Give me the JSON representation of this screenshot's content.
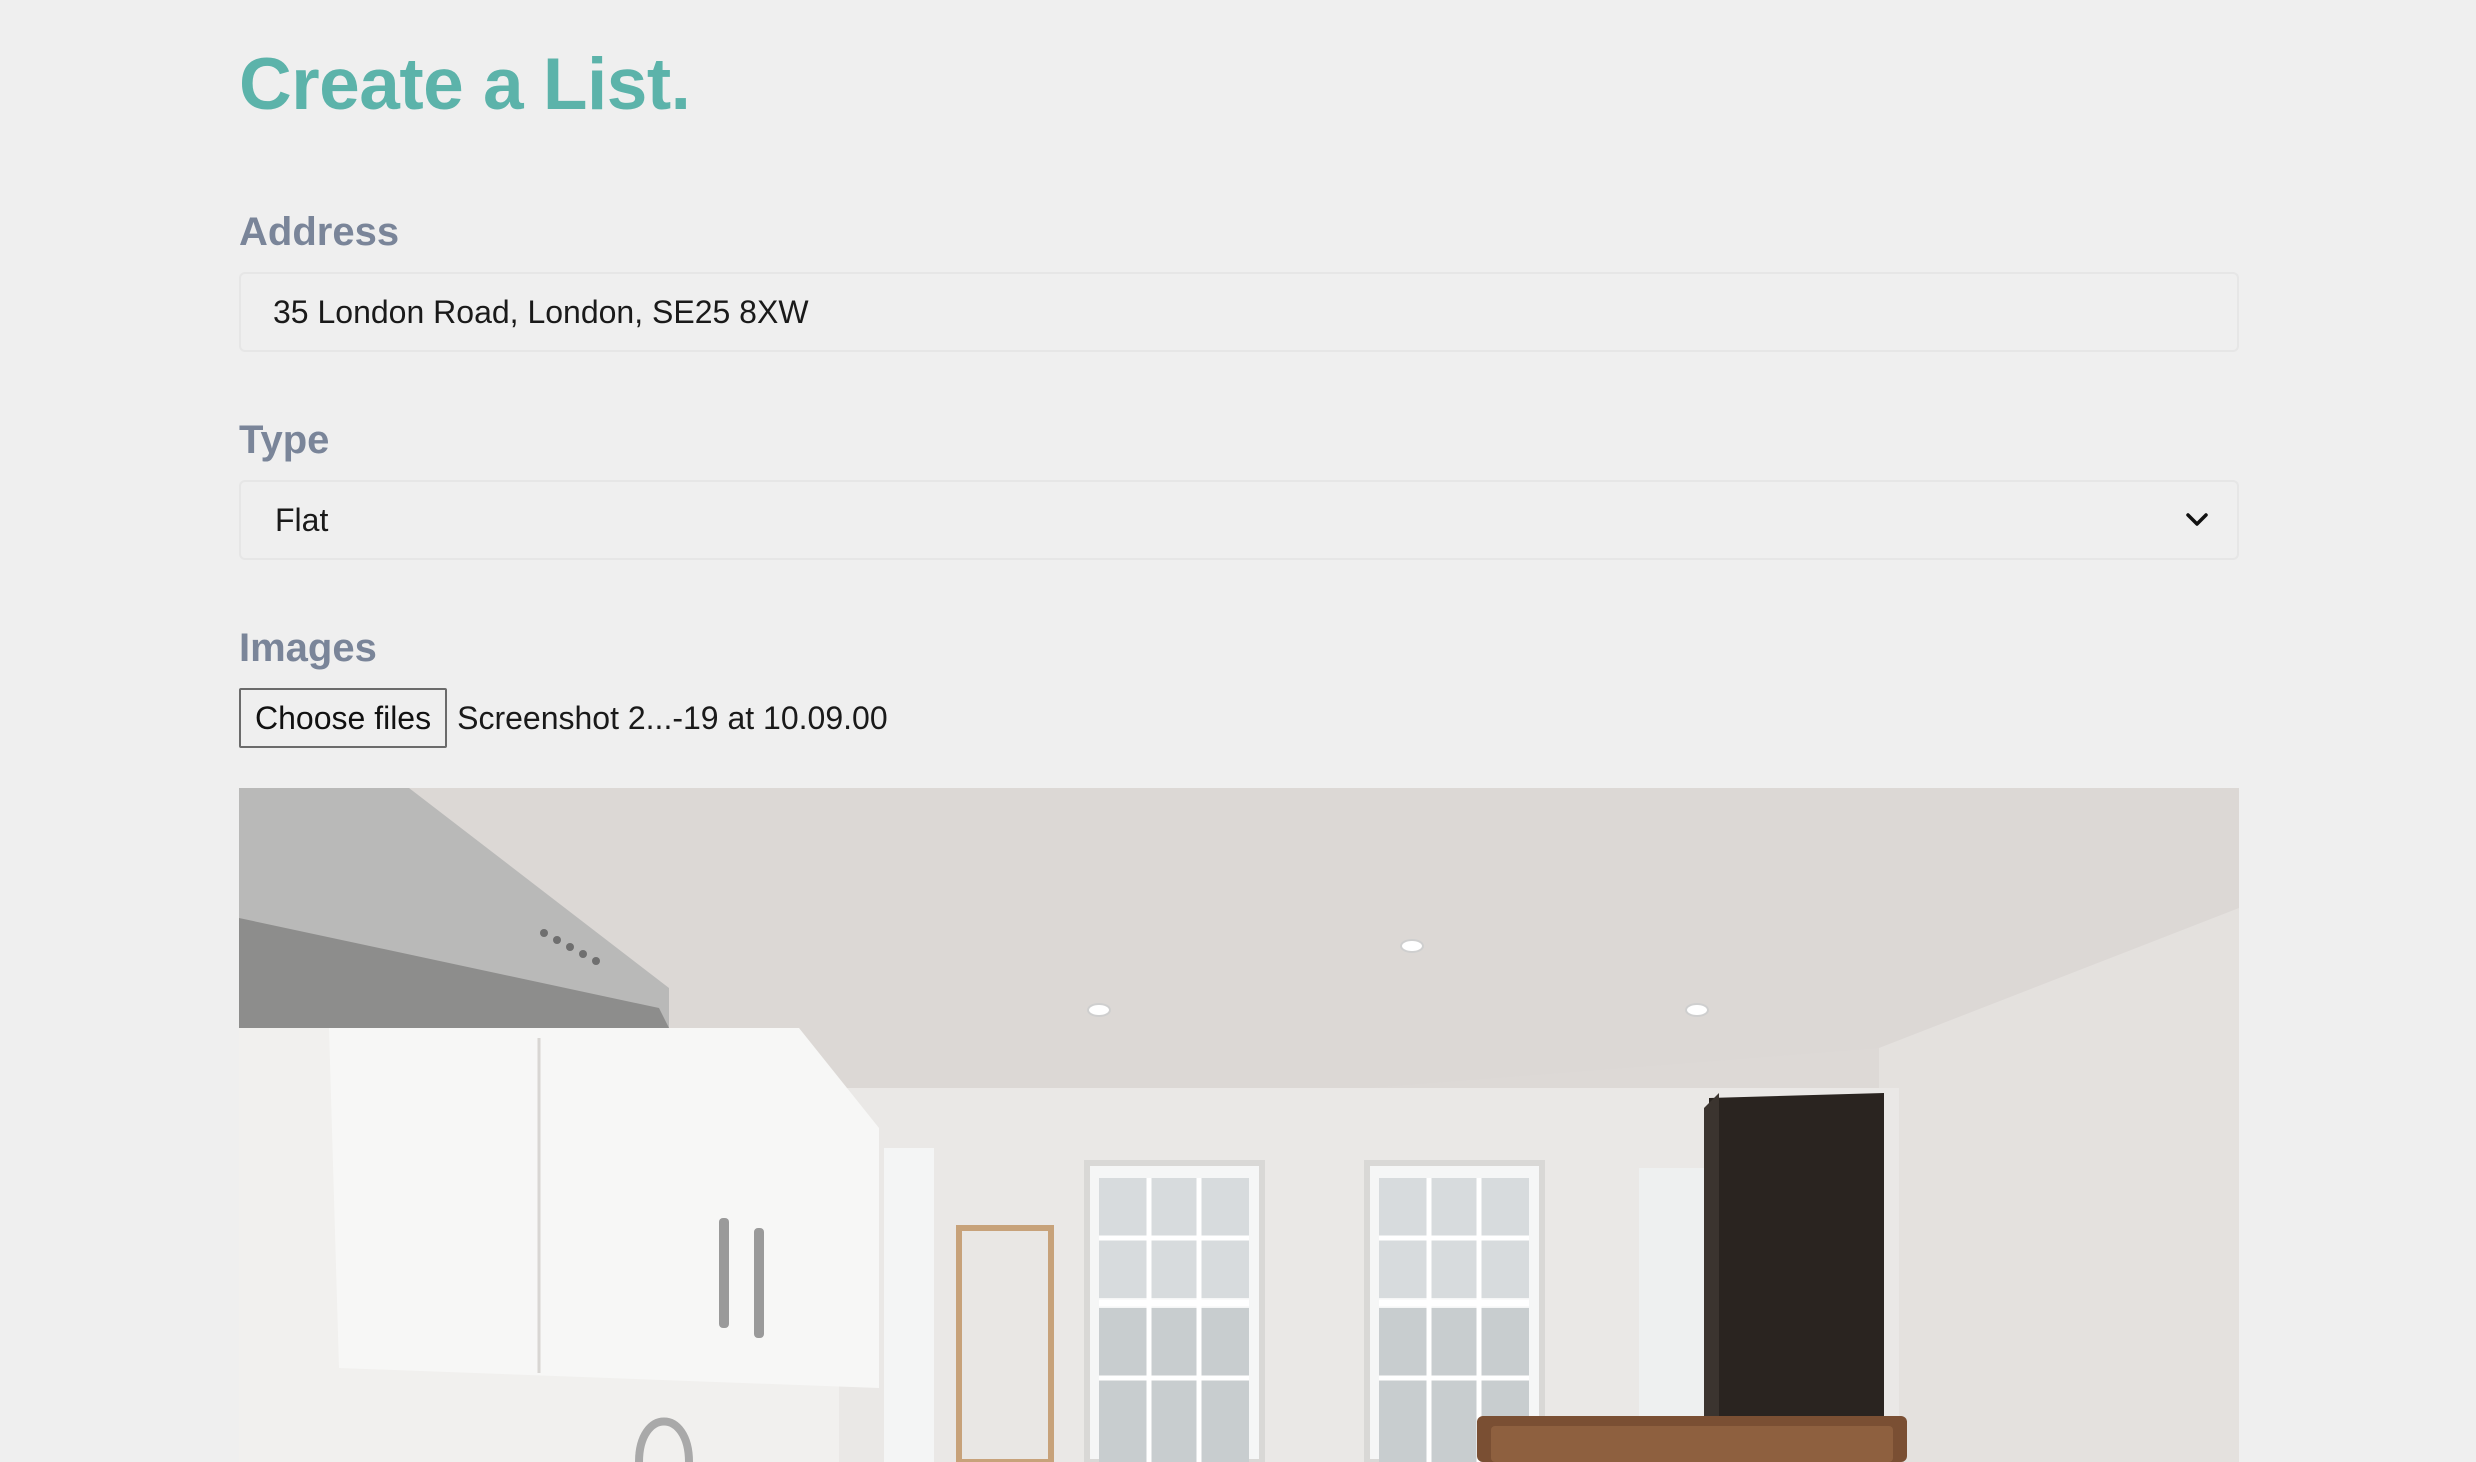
{
  "page": {
    "title": "Create a List."
  },
  "form": {
    "address": {
      "label": "Address",
      "value": "35 London Road, London, SE25 8XW"
    },
    "type": {
      "label": "Type",
      "selected": "Flat"
    },
    "images": {
      "label": "Images",
      "button_label": "Choose files",
      "file_name": "Screenshot 2...-19 at 10.09.00"
    }
  },
  "colors": {
    "title": "#5cb3aa",
    "label": "#7a8599",
    "background": "#efefef"
  },
  "icons": {
    "select_arrow": "chevron-down-icon"
  }
}
